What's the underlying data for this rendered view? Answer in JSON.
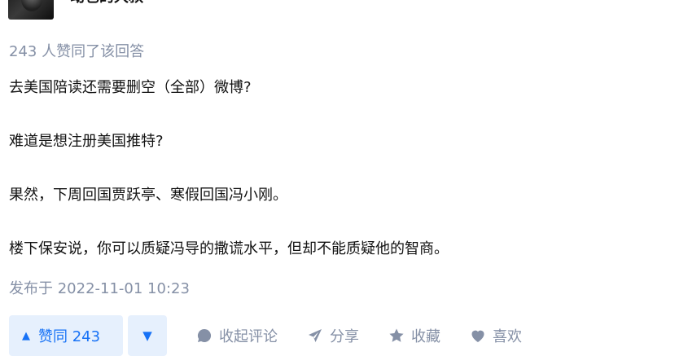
{
  "author": {
    "name": "动也的大叔"
  },
  "vote_summary": "243 人赞同了该回答",
  "paragraphs": [
    "去美国陪读还需要删空（全部）微博?",
    "难道是想注册美国推特?",
    "果然，下周回国贾跃亭、寒假回国冯小刚。",
    "楼下保安说，你可以质疑冯导的撒谎水平，但却不能质疑他的智商。"
  ],
  "publish_time": "发布于 2022-11-01 10:23",
  "actions": {
    "upvote_label": "赞同 243",
    "upvote_icon": "▲",
    "downvote_icon": "▼",
    "comment_label": "收起评论",
    "share_label": "分享",
    "collect_label": "收藏",
    "like_label": "喜欢"
  },
  "colors": {
    "accent": "#1772f6",
    "accent_bg": "#e6f0fd",
    "muted": "#8590a6",
    "text": "#121212"
  }
}
